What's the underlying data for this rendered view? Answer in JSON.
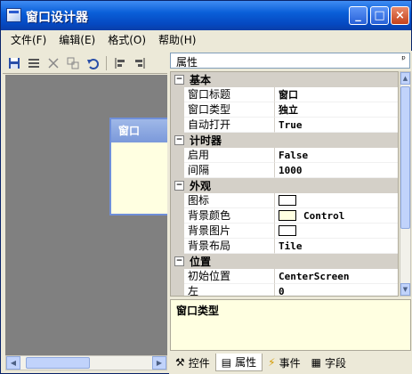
{
  "window": {
    "title": "窗口设计器",
    "buttons": {
      "minimize": "_",
      "maximize": "□",
      "close": "×"
    }
  },
  "menu": [
    {
      "label": "文件(F)"
    },
    {
      "label": "编辑(E)"
    },
    {
      "label": "格式(O)"
    },
    {
      "label": "帮助(H)"
    }
  ],
  "designer": {
    "form_caption": "窗口",
    "form_background": "#ffffe1"
  },
  "properties": {
    "header": "属性",
    "pin": "ᵖ",
    "categories": [
      {
        "name": "基本",
        "toggle": "−",
        "rows": [
          {
            "name": "窗口标题",
            "value": "窗口"
          },
          {
            "name": "窗口类型",
            "value": "独立"
          },
          {
            "name": "自动打开",
            "value": "True"
          }
        ]
      },
      {
        "name": "计时器",
        "toggle": "−",
        "rows": [
          {
            "name": "启用",
            "value": "False"
          },
          {
            "name": "间隔",
            "value": "1000"
          }
        ]
      },
      {
        "name": "外观",
        "toggle": "−",
        "rows": [
          {
            "name": "图标",
            "value": "",
            "swatch": "#ffffff"
          },
          {
            "name": "背景颜色",
            "value": "Control",
            "swatch": "#ffffe1"
          },
          {
            "name": "背景图片",
            "value": "",
            "swatch": "#ffffff"
          },
          {
            "name": "背景布局",
            "value": "Tile"
          }
        ]
      },
      {
        "name": "位置",
        "toggle": "−",
        "rows": [
          {
            "name": "初始位置",
            "value": "CenterScreen"
          },
          {
            "name": "左",
            "value": "0"
          }
        ]
      }
    ],
    "description_title": "窗口类型"
  },
  "tabs": [
    {
      "label": "控件",
      "icon": "tools-icon"
    },
    {
      "label": "属性",
      "icon": "properties-icon",
      "active": true
    },
    {
      "label": "事件",
      "icon": "lightning-icon"
    },
    {
      "label": "字段",
      "icon": "table-icon"
    }
  ]
}
